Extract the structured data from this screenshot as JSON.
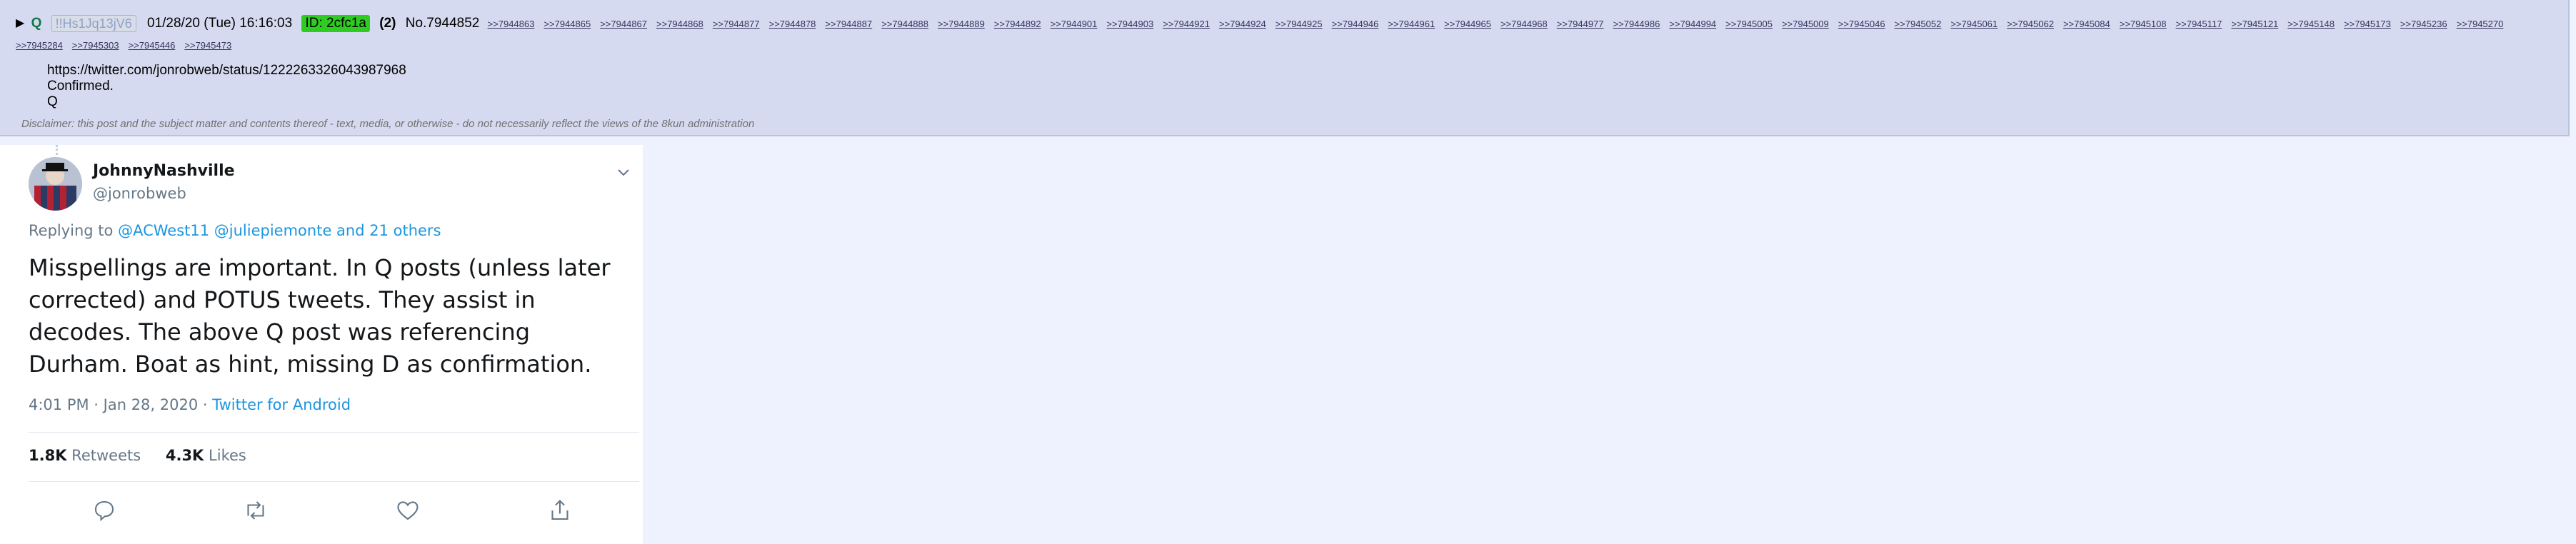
{
  "post": {
    "arrow": "▶",
    "name": "Q",
    "tripcode": "!!Hs1Jq13jV6",
    "datetime": "01/28/20 (Tue) 16:16:03",
    "id_badge": "ID: 2cfc1a",
    "reply_count": "(2)",
    "post_number": "No.7944852",
    "backlinks": [
      ">>7944863",
      ">>7944865",
      ">>7944867",
      ">>7944868",
      ">>7944877",
      ">>7944878",
      ">>7944887",
      ">>7944888",
      ">>7944889",
      ">>7944892",
      ">>7944901",
      ">>7944903",
      ">>7944921",
      ">>7944924",
      ">>7944925",
      ">>7944946",
      ">>7944961",
      ">>7944965",
      ">>7944968",
      ">>7944977",
      ">>7944986",
      ">>7944994",
      ">>7945005",
      ">>7945009",
      ">>7945046",
      ">>7945052",
      ">>7945061",
      ">>7945062",
      ">>7945084",
      ">>7945108",
      ">>7945117",
      ">>7945121",
      ">>7945148",
      ">>7945173",
      ">>7945236",
      ">>7945270",
      ">>7945284",
      ">>7945303",
      ">>7945446",
      ">>7945473"
    ],
    "body_lines": [
      "https://twitter.com/jonrobweb/status/1222263326043987968",
      "Confirmed.",
      "Q"
    ],
    "disclaimer": "Disclaimer: this post and the subject matter and contents thereof - text, media, or otherwise - do not necessarily reflect the views of the 8kun administration"
  },
  "tweet": {
    "display_name": "JohnnyNashville",
    "handle": "@jonrobweb",
    "replying_prefix": "Replying to",
    "replying_targets": "@ACWest11 @juliepiemonte and 21 others",
    "text": "Misspellings are important. In Q posts (unless later corrected) and POTUS tweets. They assist in decodes. The above Q post was referencing Durham. Boat as hint, missing D as confirmation.",
    "timestamp": "4:01 PM · Jan 28, 2020 · ",
    "source": "Twitter for Android",
    "retweets_count": "1.8K",
    "retweets_label": "Retweets",
    "likes_count": "4.3K",
    "likes_label": "Likes",
    "icons": [
      "chevron-down-icon",
      "reply-icon",
      "retweet-icon",
      "like-icon",
      "share-icon"
    ]
  },
  "colors": {
    "post_bg": "#d6daf0",
    "page_bg": "#eef2ff",
    "id_badge": "#2ecc20",
    "name_green": "#117743",
    "twitter_blue": "#1b95e0",
    "twitter_gray": "#657786"
  }
}
